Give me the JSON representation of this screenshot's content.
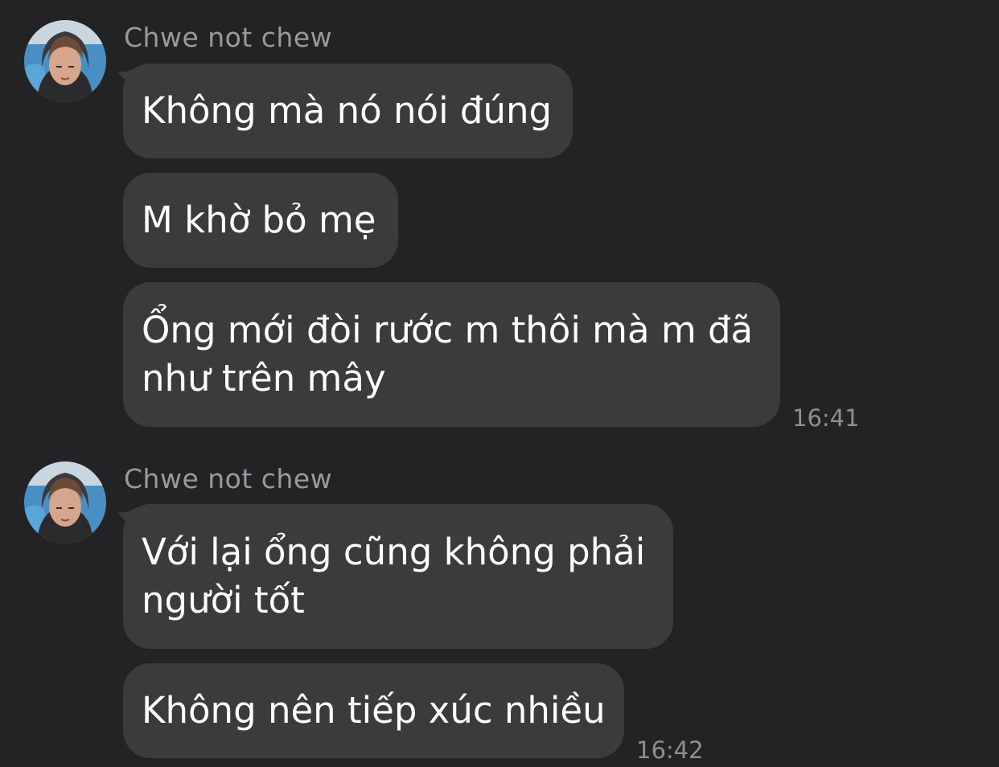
{
  "conversation": {
    "groups": [
      {
        "sender": "Chwe not chew",
        "avatar_icon": "profile-photo",
        "messages": [
          "Không mà nó nói đúng",
          "M khờ bỏ mẹ",
          "Ổng mới đòi rước m thôi mà m đã như trên mây"
        ],
        "time": "16:41"
      },
      {
        "sender": "Chwe not chew",
        "avatar_icon": "profile-photo",
        "messages": [
          "Với lại ổng cũng không phải người tốt",
          "Không nên tiếp xúc nhiều"
        ],
        "time": "16:42"
      }
    ]
  },
  "colors": {
    "background": "#232325",
    "bubble": "#3b3b3d",
    "sender_text": "#9a9a9e",
    "time_text": "#8e8e93",
    "message_text": "#ffffff"
  }
}
